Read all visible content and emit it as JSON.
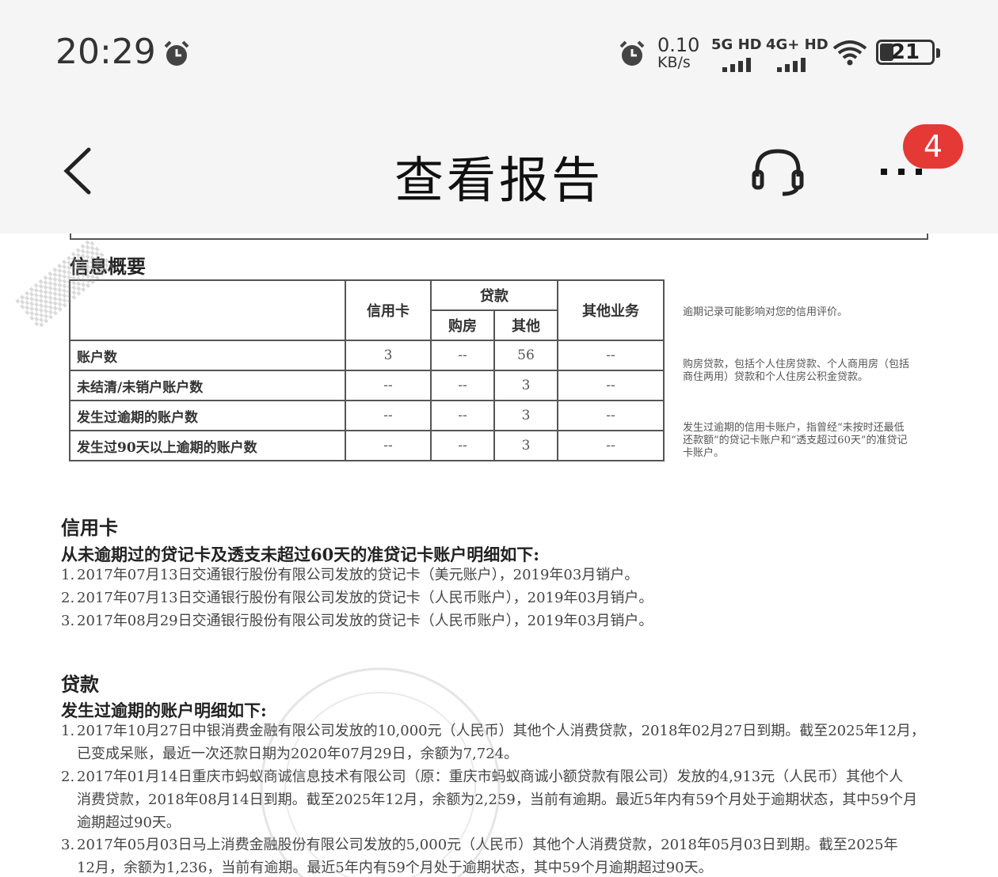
{
  "status_bar": {
    "time": "20:29",
    "net_speed_value": "0.10",
    "net_speed_unit": "KB/s",
    "sim1": "5G HD",
    "sim2": "4G+ HD",
    "battery": "21"
  },
  "nav": {
    "title": "查看报告",
    "badge_count": "4",
    "icons": [
      "back-arrow-icon",
      "headset-icon",
      "more-icon"
    ]
  },
  "summary": {
    "section_title": "信息概要",
    "col_credit": "信用卡",
    "col_loan": "贷款",
    "col_house": "购房",
    "col_other": "其他",
    "col_other_biz": "其他业务",
    "rows": [
      {
        "label": "账户数",
        "credit": "3",
        "house": "--",
        "other": "56",
        "biz": "--"
      },
      {
        "label": "未结清/未销户账户数",
        "credit": "--",
        "house": "--",
        "other": "3",
        "biz": "--"
      },
      {
        "label": "发生过逾期的账户数",
        "credit": "--",
        "house": "--",
        "other": "3",
        "biz": "--"
      },
      {
        "label": "发生过90天以上逾期的账户数",
        "credit": "--",
        "house": "--",
        "other": "3",
        "biz": "--"
      }
    ],
    "notes": [
      "逾期记录可能影响对您的信用评价。",
      "购房贷款，包括个人住房贷款、个人商用房（包括商住两用）贷款和个人住房公积金贷款。",
      "发生过逾期的信用卡账户，指曾经“未按时还最低还款额”的贷记卡账户和“透支超过60天”的准贷记卡账户。"
    ]
  },
  "credit_card": {
    "title": "信用卡",
    "subtitle": "从未逾期过的贷记卡及透支未超过60天的准贷记卡账户明细如下:",
    "items": [
      "2017年07月13日交通银行股份有限公司发放的贷记卡（美元账户），2019年03月销户。",
      "2017年07月13日交通银行股份有限公司发放的贷记卡（人民币账户），2019年03月销户。",
      "2017年08月29日交通银行股份有限公司发放的贷记卡（人民币账户），2019年03月销户。"
    ]
  },
  "loan": {
    "title": "贷款",
    "subtitle": "发生过逾期的账户明细如下:",
    "items": [
      {
        "l1": "2017年10月27日中银消费金融有限公司发放的10,000元（人民币）其他个人消费贷款，2018年02月27日到期。截至2025年12月，",
        "l2": "已变成呆账，最近一次还款日期为2020年07月29日，余额为7,724。",
        "l3": ""
      },
      {
        "l1": "2017年01月14日重庆市蚂蚁商诚信息技术有限公司（原：重庆市蚂蚁商诚小额贷款有限公司）发放的4,913元（人民币）其他个人",
        "l2": "消费贷款，2018年08月14日到期。截至2025年12月，余额为2,259，当前有逾期。最近5年内有59个月处于逾期状态，其中59个月",
        "l3": "逾期超过90天。"
      },
      {
        "l1": "2017年05月03日马上消费金融股份有限公司发放的5,000元（人民币）其他个人消费贷款，2018年05月03日到期。截至2025年",
        "l2": "12月，余额为1,236，当前有逾期。最近5年内有59个月处于逾期状态，其中59个月逾期超过90天。",
        "l3": ""
      }
    ]
  },
  "accent_colors": {
    "badge": "#e53935",
    "bar_bg": "#f5f5f5"
  }
}
